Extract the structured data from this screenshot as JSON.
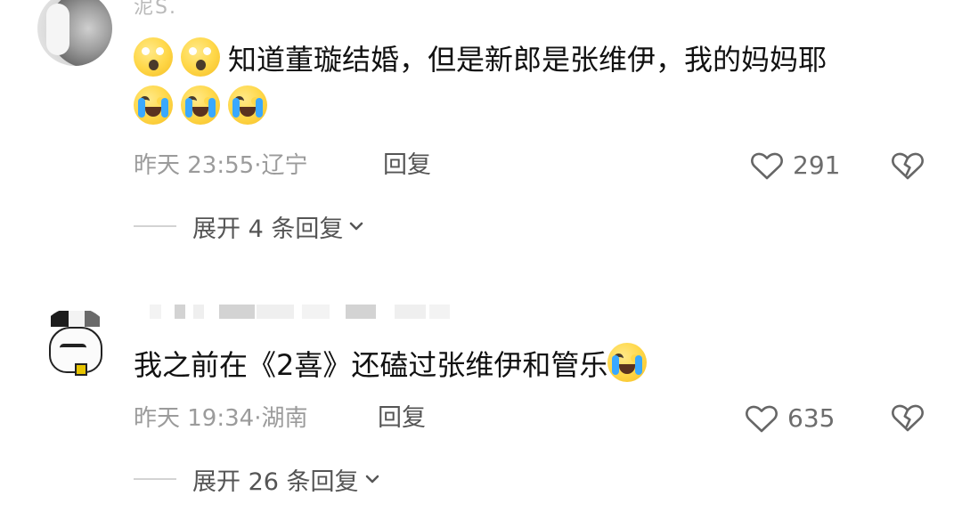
{
  "comments": [
    {
      "username_fragment": "泥S.",
      "emoji_sequence": [
        "face-with-open-mouth",
        "face-with-open-mouth"
      ],
      "text": "知道董璇结婚，但是新郎是张维伊，我的妈妈耶",
      "trailing_emojis": [
        "crying-face",
        "crying-face",
        "crying-face"
      ],
      "time": "昨天 23:55",
      "location": "辽宁",
      "reply_label": "回复",
      "likes": "291",
      "expand_label": "展开 4 条回复"
    },
    {
      "username_fragment": "",
      "emoji_sequence": [],
      "text": "我之前在《2喜》还磕过张维伊和管乐",
      "trailing_emojis": [
        "crying-face"
      ],
      "time": "昨天 19:34",
      "location": "湖南",
      "reply_label": "回复",
      "likes": "635",
      "expand_label": "展开 26 条回复"
    }
  ],
  "icons": {
    "like": "heart-outline-icon",
    "dislike": "broken-heart-icon",
    "expand": "chevron-down-icon"
  },
  "colors": {
    "primary_text": "#111111",
    "secondary_text": "#9b9b9b",
    "action_text": "#555555",
    "divider": "#d3d3d3",
    "emoji": "#ffd84a",
    "tear": "#39a8ff"
  }
}
